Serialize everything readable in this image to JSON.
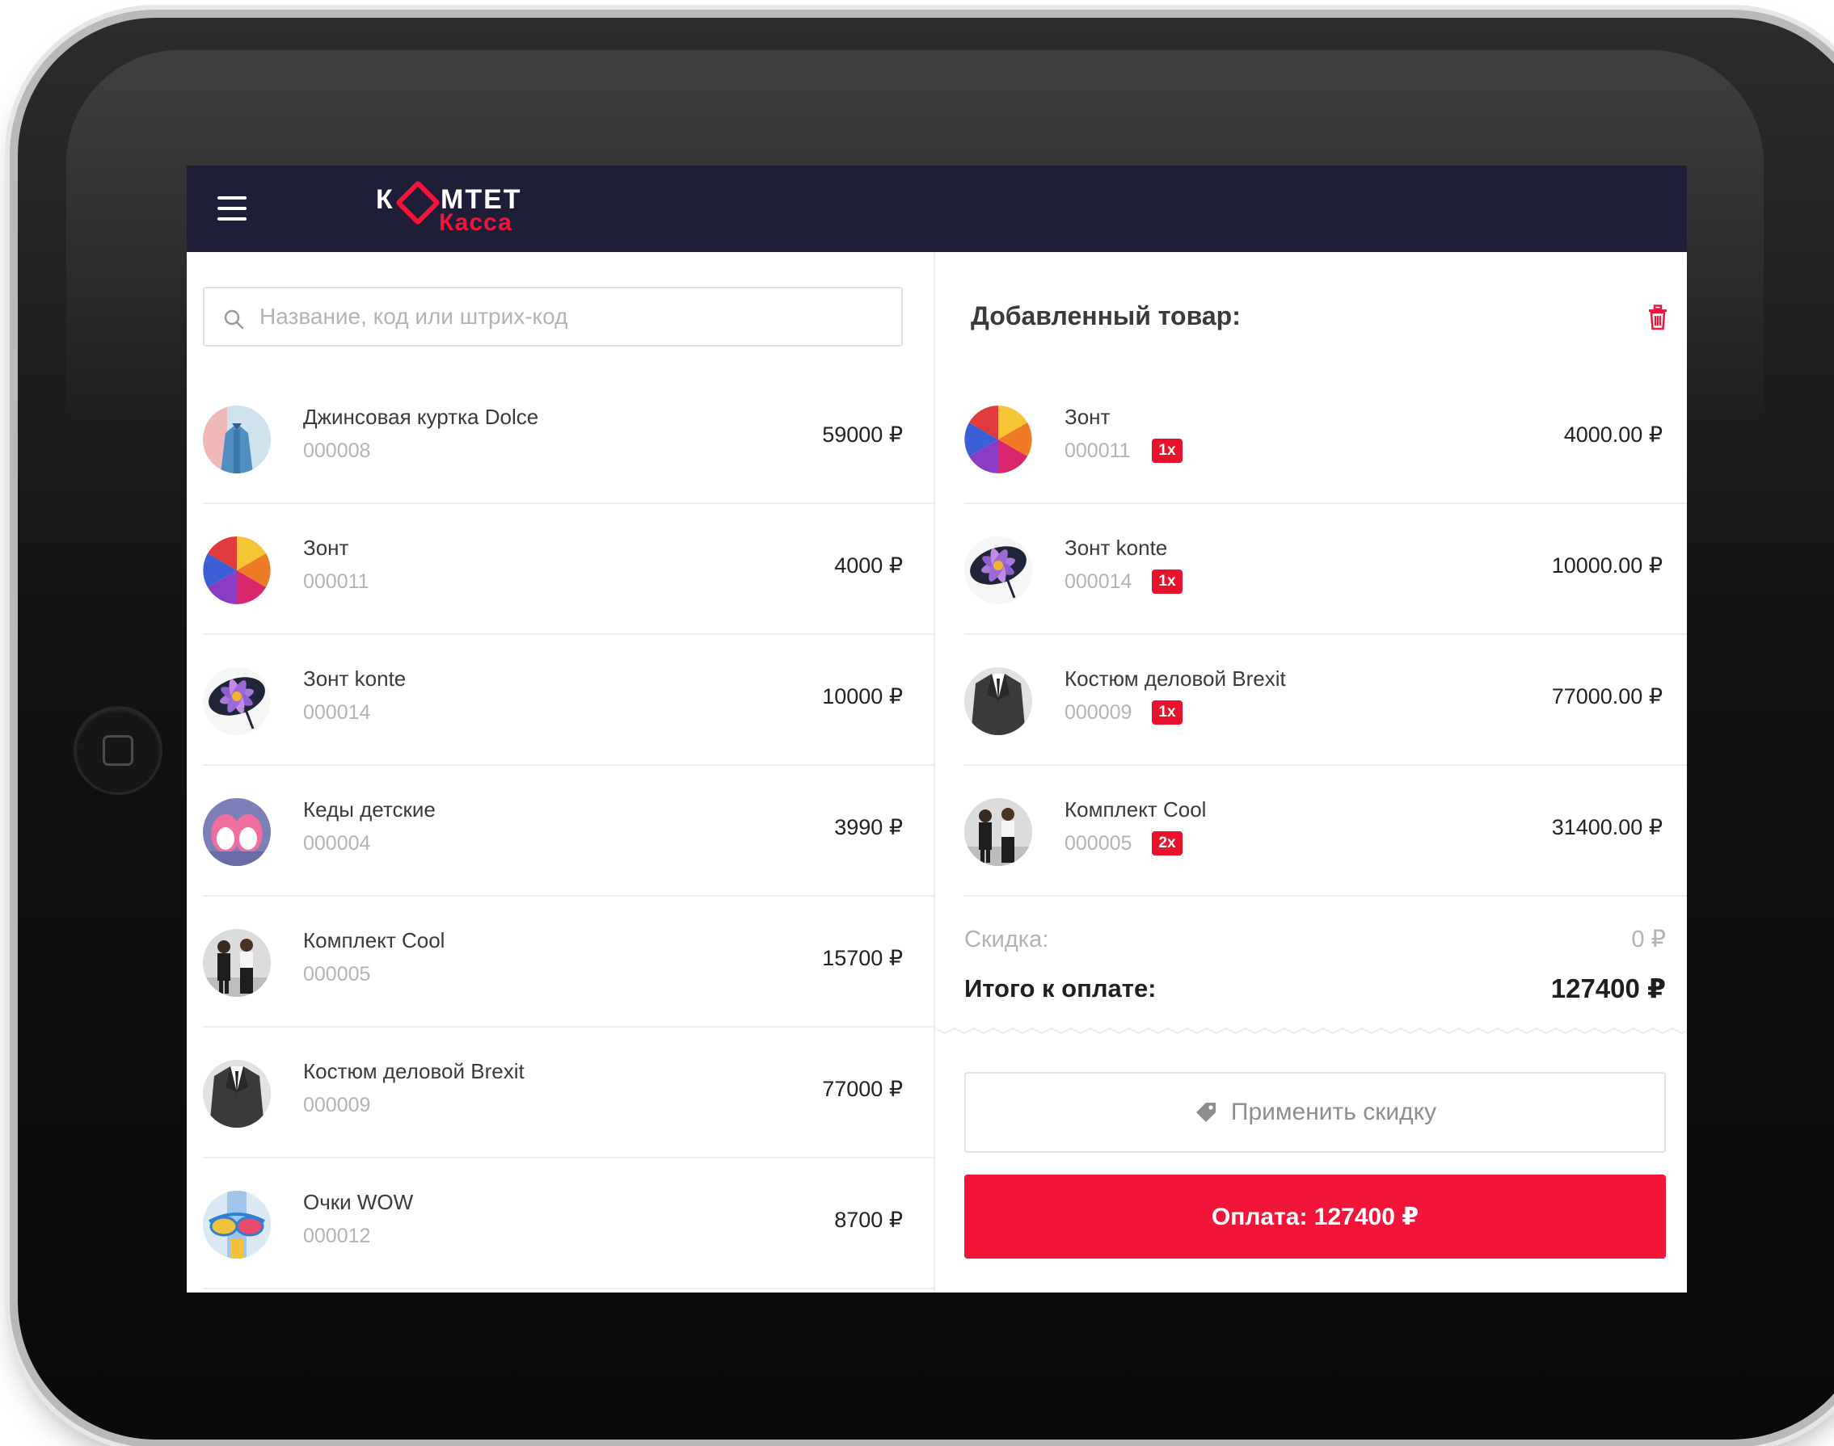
{
  "header": {
    "logo_line1_a": "К",
    "logo_line1_b": "МТЕТ",
    "logo_line2": "Касса"
  },
  "search": {
    "placeholder": "Название, код или штрих-код",
    "value": ""
  },
  "products": [
    {
      "name": "Джинсовая куртка Dolce",
      "code": "000008",
      "price": "59000 ₽",
      "thumb": "jacket"
    },
    {
      "name": "Зонт",
      "code": "000011",
      "price": "4000 ₽",
      "thumb": "umbrella"
    },
    {
      "name": "Зонт konte",
      "code": "000014",
      "price": "10000 ₽",
      "thumb": "umbrella-flower"
    },
    {
      "name": "Кеды детские",
      "code": "000004",
      "price": "3990 ₽",
      "thumb": "sneakers"
    },
    {
      "name": "Комплект Cool",
      "code": "000005",
      "price": "15700 ₽",
      "thumb": "outfit"
    },
    {
      "name": "Костюм деловой Brexit",
      "code": "000009",
      "price": "77000 ₽",
      "thumb": "suit"
    },
    {
      "name": "Очки WOW",
      "code": "000012",
      "price": "8700 ₽",
      "thumb": "glasses"
    }
  ],
  "cart": {
    "title": "Добавленный товар:",
    "items": [
      {
        "name": "Зонт",
        "code": "000011",
        "qty": "1x",
        "price": "4000.00 ₽",
        "thumb": "umbrella"
      },
      {
        "name": "Зонт konte",
        "code": "000014",
        "qty": "1x",
        "price": "10000.00 ₽",
        "thumb": "umbrella-flower"
      },
      {
        "name": "Костюм деловой Brexit",
        "code": "000009",
        "qty": "1x",
        "price": "77000.00 ₽",
        "thumb": "suit"
      },
      {
        "name": "Комплект Cool",
        "code": "000005",
        "qty": "2x",
        "price": "31400.00 ₽",
        "thumb": "outfit"
      }
    ],
    "discount_label": "Скидка:",
    "discount_value": "0 ₽",
    "total_label": "Итого к оплате:",
    "total_value": "127400 ₽",
    "apply_discount_label": "Применить скидку",
    "pay_label": "Оплата: 127400 ₽"
  },
  "colors": {
    "header_bg": "#1e1e39",
    "accent": "#f21439",
    "badge": "#e8122d"
  },
  "icons": {
    "menu": "menu-icon",
    "search": "search-icon",
    "trash": "trash-icon",
    "tag": "tag-icon"
  }
}
